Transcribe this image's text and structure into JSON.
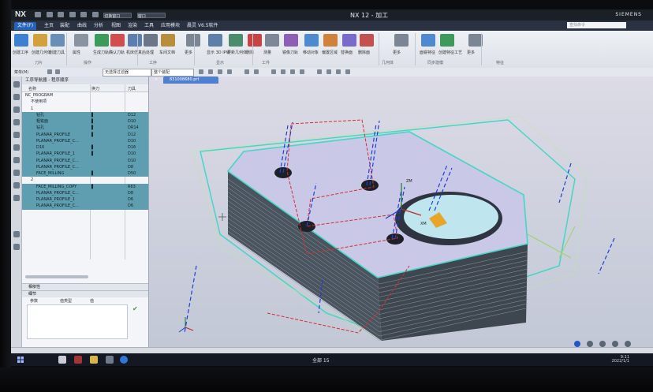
{
  "window": {
    "app_logo": "NX",
    "title": "NX 12 - 加工",
    "brand": "SIEMENS",
    "quick_access_window": "切换窗口",
    "quick_access_window2": "窗口"
  },
  "tabs": [
    {
      "label": "文件(F)"
    },
    {
      "label": "主页"
    },
    {
      "label": "装配"
    },
    {
      "label": "曲线"
    },
    {
      "label": "分析"
    },
    {
      "label": "视图"
    },
    {
      "label": "渲染"
    },
    {
      "label": "工具"
    },
    {
      "label": "应用模块"
    },
    {
      "label": "晨灵 V6.5软件"
    }
  ],
  "search_placeholder": "查找命令",
  "ribbon": {
    "buttons": [
      {
        "label": "创建工序",
        "icon": "create-operation-icon"
      },
      {
        "label": "创建几何体",
        "icon": "create-geometry-icon"
      },
      {
        "label": "创建刀具",
        "icon": "create-tool-icon"
      },
      {
        "label": "属性",
        "icon": "properties-icon"
      },
      {
        "label": "生成刀轨",
        "icon": "generate-toolpath-icon"
      },
      {
        "label": "确认刀轨",
        "icon": "verify-toolpath-icon"
      },
      {
        "label": "机床仿真",
        "icon": "machine-simulation-icon"
      },
      {
        "label": "后处理",
        "icon": "postprocess-icon"
      },
      {
        "label": "车间文档",
        "icon": "shop-document-icon"
      },
      {
        "label": "更多",
        "icon": "more-icon"
      },
      {
        "label": "显示 3D IPW",
        "icon": "ipw-icon"
      },
      {
        "label": "更新几何体",
        "icon": "update-geometry-icon"
      },
      {
        "label": "删除",
        "icon": "delete-icon"
      },
      {
        "label": "测量",
        "icon": "measure-icon"
      },
      {
        "label": "镜像刀轨",
        "icon": "mirror-icon"
      },
      {
        "label": "移动对象",
        "icon": "move-icon"
      },
      {
        "label": "偏置区域",
        "icon": "offset-icon"
      },
      {
        "label": "替换面",
        "icon": "replace-face-icon"
      },
      {
        "label": "删除面",
        "icon": "delete-face-icon"
      },
      {
        "label": "更多",
        "icon": "more-icon"
      },
      {
        "label": "面铣特征",
        "icon": "face-feature-icon"
      },
      {
        "label": "创建特征工艺",
        "icon": "feature-process-icon"
      },
      {
        "label": "更多",
        "icon": "more-icon"
      }
    ],
    "groups": [
      "刀片",
      "操作",
      "工序",
      "显示",
      "工件",
      "几何体",
      "同步建模",
      "特征"
    ]
  },
  "toolbar2": {
    "menu_label": "菜单(M)",
    "filter": "无选择过滤器",
    "scope": "整个装配"
  },
  "navigator": {
    "title": "工序导航器 - 程序顺序",
    "columns": [
      "名称",
      "换刀",
      "刀具"
    ],
    "rows": [
      {
        "name": "NC_PROGRAM",
        "tool": "",
        "indent": 0,
        "selected": false,
        "change": ""
      },
      {
        "name": "不使用项",
        "tool": "",
        "indent": 1,
        "selected": false,
        "change": ""
      },
      {
        "name": "1",
        "tool": "",
        "indent": 1,
        "selected": false,
        "change": ""
      },
      {
        "name": "钻孔",
        "tool": "D12",
        "indent": 2,
        "selected": true,
        "change": "▌"
      },
      {
        "name": "粗铣面",
        "tool": "D10",
        "indent": 2,
        "selected": true,
        "change": "▌"
      },
      {
        "name": "钻孔",
        "tool": "DR14",
        "indent": 2,
        "selected": true,
        "change": "▌"
      },
      {
        "name": "PLANAR_PROFILE",
        "tool": "D12",
        "indent": 2,
        "selected": true,
        "change": "▌"
      },
      {
        "name": "PLANAR_PROFILE_C...",
        "tool": "D10",
        "indent": 2,
        "selected": true,
        "change": ""
      },
      {
        "name": "D16",
        "tool": "D16",
        "indent": 2,
        "selected": true,
        "change": "▌"
      },
      {
        "name": "PLANAR_PROFILE_1",
        "tool": "D10",
        "indent": 2,
        "selected": true,
        "change": "▌"
      },
      {
        "name": "PLANAR_PROFILE_C...",
        "tool": "D10",
        "indent": 2,
        "selected": true,
        "change": ""
      },
      {
        "name": "PLANAR_PROFILE_C...",
        "tool": "D8",
        "indent": 2,
        "selected": true,
        "change": ""
      },
      {
        "name": "FACE_MILLING",
        "tool": "D50",
        "indent": 2,
        "selected": true,
        "change": "▌"
      },
      {
        "name": "2",
        "tool": "",
        "indent": 1,
        "selected": false,
        "change": ""
      },
      {
        "name": "FACE_MILLING_COPY",
        "tool": "R63",
        "indent": 2,
        "selected": true,
        "change": "▌"
      },
      {
        "name": "PLANAR_PROFILE_C...",
        "tool": "D8",
        "indent": 2,
        "selected": true,
        "change": ""
      },
      {
        "name": "PLANAR_PROFILE_1",
        "tool": "D6",
        "indent": 2,
        "selected": true,
        "change": ""
      },
      {
        "name": "PLANAR_PROFILE_C...",
        "tool": "D6",
        "indent": 2,
        "selected": true,
        "change": ""
      }
    ],
    "dependencies_label": "相依性",
    "details_label": "细节",
    "detail_columns": [
      "参数",
      "值类型",
      "值"
    ]
  },
  "viewport": {
    "file_tab": "831008680.prt",
    "axis_labels": [
      "ZM",
      "XM"
    ]
  },
  "statusbar": {
    "center_text": "全部 15"
  },
  "taskbar": {
    "time": "9:11",
    "date": "2022/1/1"
  },
  "colors": {
    "accent": "#2463b7",
    "selection": "#5f9eb0",
    "part": "#c9c8e6",
    "wall": "#55606a",
    "toolpath_blue": "#1f3fd4",
    "toolpath_red": "#d23030",
    "stock_cyan": "#45d6c6"
  }
}
